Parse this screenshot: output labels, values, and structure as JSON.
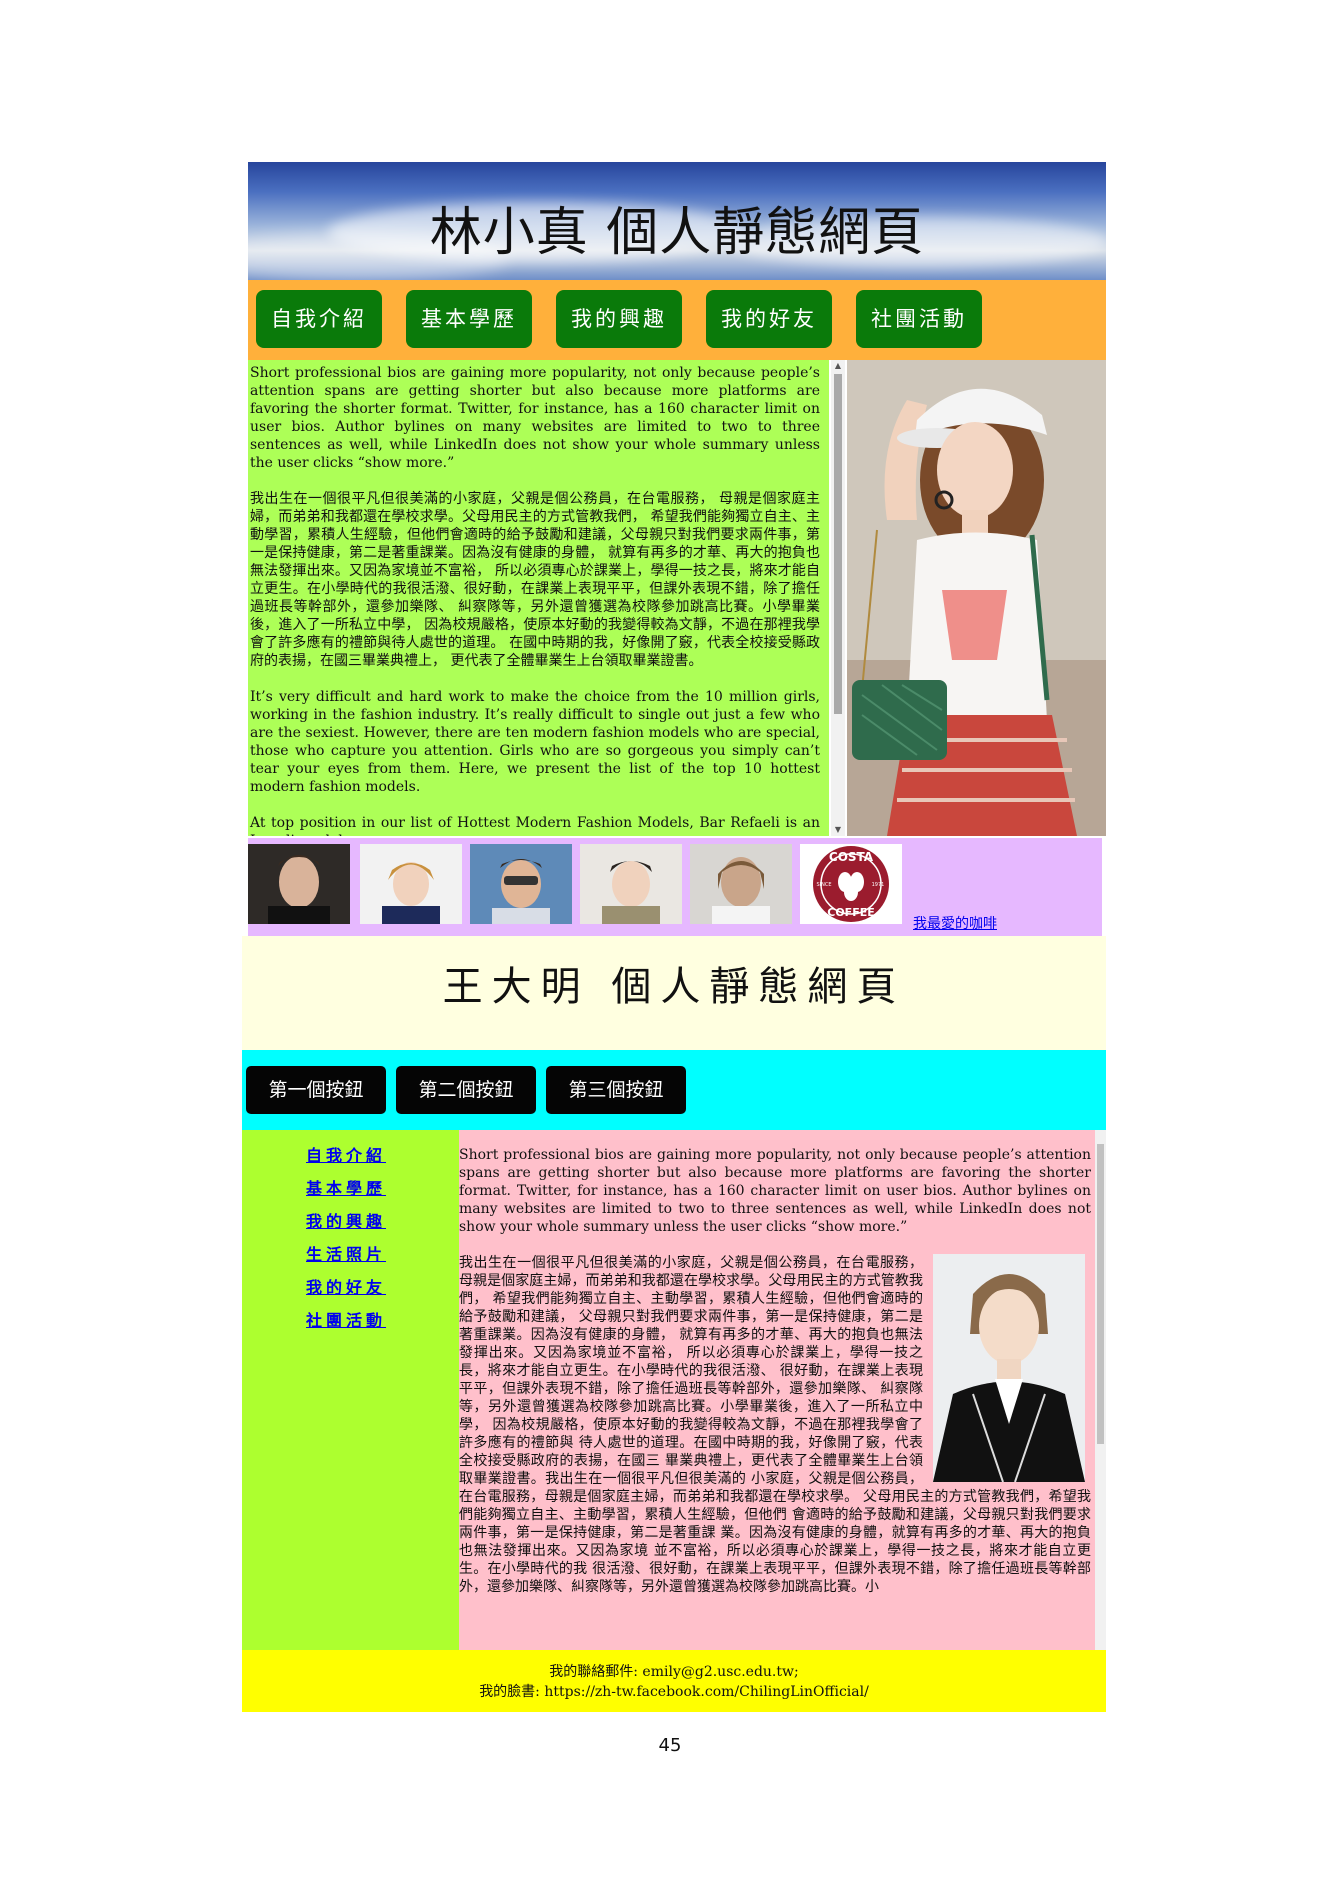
{
  "site1": {
    "title": "林小真 個人靜態網頁",
    "nav": [
      "自我介紹",
      "基本學歷",
      "我的興趣",
      "我的好友",
      "社團活動"
    ],
    "paragraphs": [
      "Short professional bios are gaining more popularity, not only because people’s attention spans are getting shorter but also because more platforms are favoring the shorter format. Twitter, for instance, has a 160 character limit on user bios. Author bylines on many websites are limited to two to three sentences as well, while LinkedIn does not show your whole summary unless the user clicks “show more.”",
      "我出生在一個很平凡但很美滿的小家庭，父親是個公務員，在台電服務， 母親是個家庭主婦，而弟弟和我都還在學校求學。父母用民主的方式管教我們， 希望我們能夠獨立自主、主動學習，累積人生經驗，但他們會適時的給予鼓勵和建議，父母親只對我們要求兩件事，第一是保持健康，第二是著重課業。因為沒有健康的身體， 就算有再多的才華、再大的抱負也無法發揮出來。又因為家境並不富裕， 所以必須專心於課業上，學得一技之長，將來才能自立更生。在小學時代的我很活潑、很好動，在課業上表現平平，但課外表現不錯，除了擔任過班長等幹部外，還參加樂隊、 糾察隊等，另外還曾獲選為校隊參加跳高比賽。小學畢業後，進入了一所私立中學， 因為校規嚴格，使原本好動的我變得較為文靜，不過在那裡我學會了許多應有的禮節與待人處世的道理。 在國中時期的我，好像開了竅，代表全校接受縣政府的表揚，在國三畢業典禮上， 更代表了全體畢業生上台領取畢業證書。",
      "It’s very difficult and hard work to make the choice from the 10 million girls, working in the fashion industry. It’s really difficult to single out just a few who are the sexiest. However, there are ten modern fashion models who are special, those who capture you attention. Girls who are so gorgeous you simply can’t tear your eyes from them. Here, we present the list of the top 10 hottest modern fashion models.",
      "At top position in our list of Hottest Modern Fashion Models, Bar Refaeli is an Israeli model."
    ],
    "gallery_link": "我最愛的咖啡",
    "coffee_logo_top": "COSTA",
    "coffee_logo_bottom": "COFFEE",
    "coffee_logo_left": "SINCE",
    "coffee_logo_right": "1971"
  },
  "site2": {
    "title": "王大明 個人靜態網頁",
    "buttons": [
      "第一個按鈕",
      "第二個按鈕",
      "第三個按鈕"
    ],
    "sidebar": [
      "自我介紹",
      "基本學歷",
      "我的興趣",
      "生活照片",
      "我的好友",
      "社團活動"
    ],
    "paragraphs": [
      "Short professional bios are gaining more popularity, not only because people’s attention spans are getting shorter but also because more platforms are favoring the shorter format. Twitter, for instance, has a 160 character limit on user bios. Author bylines on many websites are limited to two to three sentences as well, while LinkedIn does not show your whole summary unless the user clicks “show more.”",
      "我出生在一個很平凡但很美滿的小家庭，父親是個公務員，在台電服務， 母親是個家庭主婦，而弟弟和我都還在學校求學。父母用民主的方式管教我們， 希望我們能夠獨立自主、主動學習，累積人生經驗，但他們會適時的給予鼓勵和建議， 父母親只對我們要求兩件事，第一是保持健康，第二是著重課業。因為沒有健康的身體， 就算有再多的才華、再大的抱負也無法發揮出來。又因為家境並不富裕， 所以必須專心於課業上，學得一技之長，將來才能自立更生。在小學時代的我很活潑、 很好動，在課業上表現平平，但課外表現不錯，除了擔任過班長等幹部外，還參加樂隊、 糾察隊等，另外還曾獲選為校隊參加跳高比賽。小學畢業後，進入了一所私立中學， 因為校規嚴格，使原本好動的我變得較為文靜，不過在那裡我學會了許多應有的禮節與 待人處世的道理。在國中時期的我，好像開了竅，代表全校接受縣政府的表揚，在國三 畢業典禮上，更代表了全體畢業生上台領取畢業證書。我出生在一個很平凡但很美滿的 小家庭，父親是個公務員，在台電服務，母親是個家庭主婦，而弟弟和我都還在學校求學。 父母用民主的方式管教我們，希望我們能夠獨立自主、主動學習，累積人生經驗，但他們 會適時的給予鼓勵和建議，父母親只對我們要求兩件事，第一是保持健康，第二是著重課 業。因為沒有健康的身體，就算有再多的才華、再大的抱負也無法發揮出來。又因為家境 並不富裕，所以必須專心於課業上，學得一技之長，將來才能自立更生。在小學時代的我 很活潑、很好動，在課業上表現平平，但課外表現不錯，除了擔任過班長等幹部外，還參加樂隊、糾察隊等，另外還曾獲選為校隊參加跳高比賽。小"
    ],
    "footer_line1": "我的聯絡郵件: emily@g2.usc.edu.tw;",
    "footer_line2": "我的臉書: https://zh-tw.facebook.com/ChilingLinOfficial/"
  },
  "page_number": "45"
}
